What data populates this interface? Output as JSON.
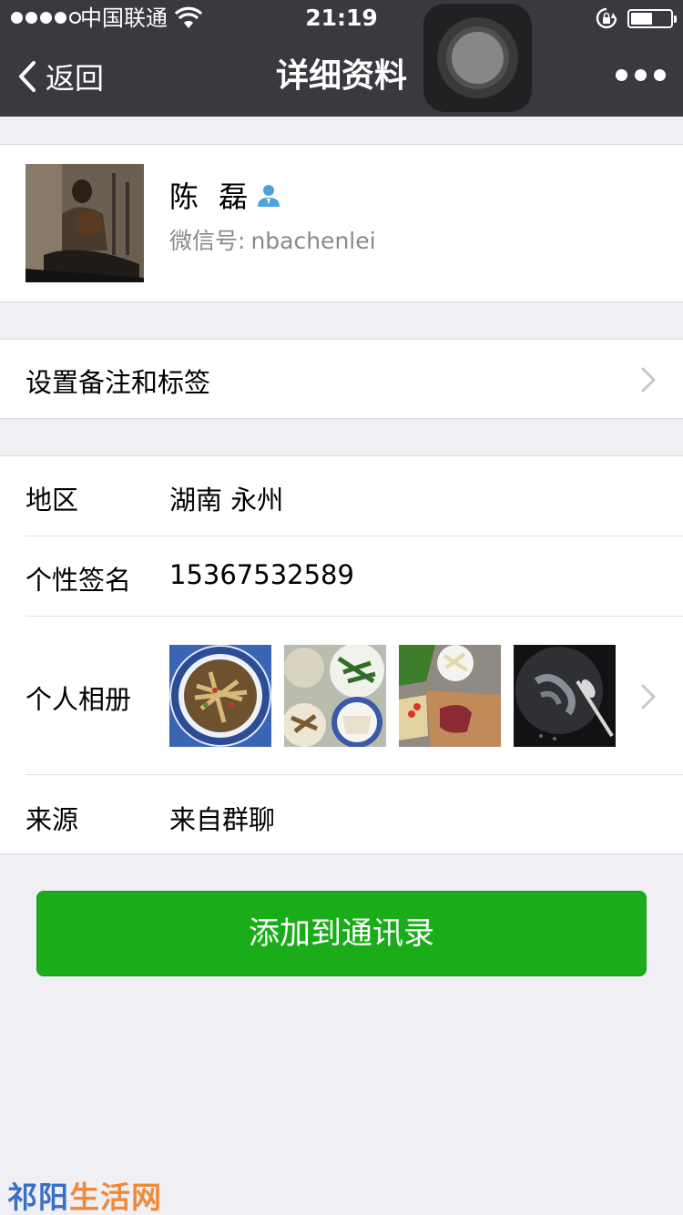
{
  "status_bar": {
    "carrier": "中国联通",
    "time": "21:19",
    "battery_level": 0.55
  },
  "nav": {
    "back_label": "返回",
    "title": "详细资料"
  },
  "profile": {
    "name": "陈 磊",
    "wechat_id_label": "微信号:",
    "wechat_id": "nbachenlei"
  },
  "remark_row": {
    "label": "设置备注和标签"
  },
  "info": {
    "region_label": "地区",
    "region_value": "湖南 永州",
    "signature_label": "个性签名",
    "signature_value": "15367532589",
    "album_label": "个人相册",
    "source_label": "来源",
    "source_value": "来自群聊"
  },
  "add_button": {
    "label": "添加到通讯录"
  },
  "watermark": {
    "part1": "祁阳",
    "part2": "生活网"
  },
  "colors": {
    "nav_bg": "#393a3f",
    "page_bg": "#efeff4",
    "primary_green": "#1aad19",
    "contact_icon": "#4aa3df"
  }
}
